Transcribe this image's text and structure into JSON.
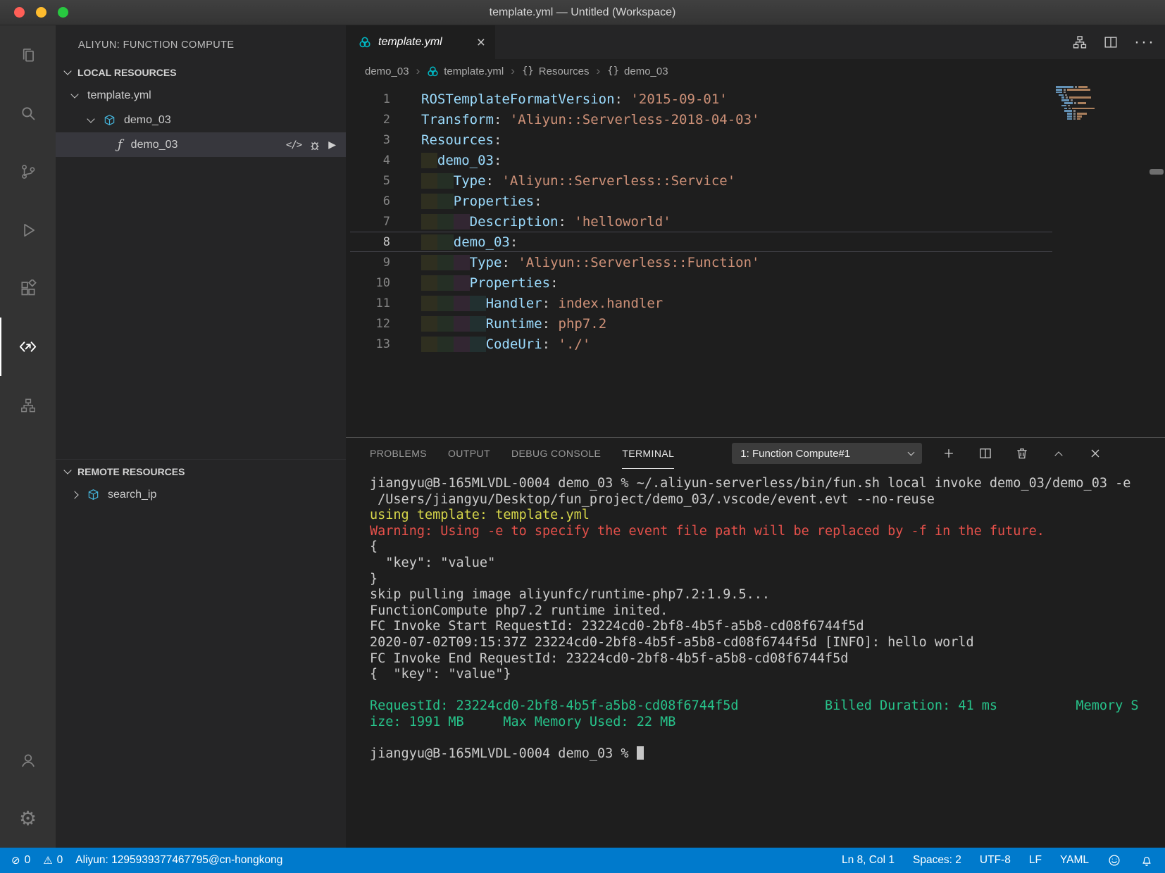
{
  "window": {
    "title": "template.yml — Untitled (Workspace)"
  },
  "colors": {
    "statusbar": "#007acc",
    "yaml_key": "#9cdcfe",
    "yaml_string": "#ce9178",
    "terminal_yellow": "#d6d64a",
    "terminal_red": "#e4504a",
    "terminal_green": "#27c28a"
  },
  "activitybar": {
    "items": [
      "explorer",
      "search",
      "source-control",
      "run-debug",
      "extensions",
      "aliyun-serverless",
      "deploy-tool",
      "accounts",
      "settings"
    ],
    "active": "aliyun-serverless"
  },
  "sidebar": {
    "title": "ALIYUN: FUNCTION COMPUTE",
    "local_header": "LOCAL RESOURCES",
    "remote_header": "REMOTE RESOURCES",
    "local_items": [
      {
        "label": "template.yml",
        "chevron": "down",
        "icon": "none",
        "indent": 0
      },
      {
        "label": "demo_03",
        "chevron": "down",
        "icon": "cube",
        "indent": 1
      },
      {
        "label": "demo_03",
        "chevron": "none",
        "icon": "function",
        "indent": 2,
        "selected": true,
        "actions": [
          "code",
          "debug",
          "run"
        ]
      }
    ],
    "remote_items": [
      {
        "label": "search_ip",
        "chevron": "right",
        "icon": "cube",
        "indent": 0
      }
    ]
  },
  "editor": {
    "tab": {
      "label": "template.yml"
    },
    "breadcrumbs": [
      {
        "label": "demo_03",
        "icon": "none"
      },
      {
        "label": "template.yml",
        "icon": "aliyun"
      },
      {
        "label": "Resources",
        "icon": "braces"
      },
      {
        "label": "demo_03",
        "icon": "braces"
      }
    ],
    "current_line": 8,
    "lines": [
      {
        "n": 1,
        "i": 0,
        "tk": [
          [
            "k",
            "ROSTemplateFormatVersion"
          ],
          [
            "p",
            ": "
          ],
          [
            "s",
            "'2015-09-01'"
          ]
        ]
      },
      {
        "n": 2,
        "i": 0,
        "tk": [
          [
            "k",
            "Transform"
          ],
          [
            "p",
            ": "
          ],
          [
            "s",
            "'Aliyun::Serverless-2018-04-03'"
          ]
        ]
      },
      {
        "n": 3,
        "i": 0,
        "tk": [
          [
            "k",
            "Resources"
          ],
          [
            "p",
            ":"
          ]
        ]
      },
      {
        "n": 4,
        "i": 1,
        "tk": [
          [
            "k",
            "demo_03"
          ],
          [
            "p",
            ":"
          ]
        ]
      },
      {
        "n": 5,
        "i": 2,
        "tk": [
          [
            "k",
            "Type"
          ],
          [
            "p",
            ": "
          ],
          [
            "s",
            "'Aliyun::Serverless::Service'"
          ]
        ]
      },
      {
        "n": 6,
        "i": 2,
        "tk": [
          [
            "k",
            "Properties"
          ],
          [
            "p",
            ":"
          ]
        ]
      },
      {
        "n": 7,
        "i": 3,
        "tk": [
          [
            "k",
            "Description"
          ],
          [
            "p",
            ": "
          ],
          [
            "s",
            "'helloworld'"
          ]
        ]
      },
      {
        "n": 8,
        "i": 2,
        "tk": [
          [
            "k",
            "demo_03"
          ],
          [
            "p",
            ":"
          ]
        ]
      },
      {
        "n": 9,
        "i": 3,
        "tk": [
          [
            "k",
            "Type"
          ],
          [
            "p",
            ": "
          ],
          [
            "s",
            "'Aliyun::Serverless::Function'"
          ]
        ]
      },
      {
        "n": 10,
        "i": 3,
        "tk": [
          [
            "k",
            "Properties"
          ],
          [
            "p",
            ":"
          ]
        ]
      },
      {
        "n": 11,
        "i": 4,
        "tk": [
          [
            "k",
            "Handler"
          ],
          [
            "p",
            ": "
          ],
          [
            "s",
            "index.handler"
          ]
        ]
      },
      {
        "n": 12,
        "i": 4,
        "tk": [
          [
            "k",
            "Runtime"
          ],
          [
            "p",
            ": "
          ],
          [
            "s",
            "php7.2"
          ]
        ]
      },
      {
        "n": 13,
        "i": 4,
        "tk": [
          [
            "k",
            "CodeUri"
          ],
          [
            "p",
            ": "
          ],
          [
            "s",
            "'./'"
          ]
        ]
      }
    ]
  },
  "panel": {
    "tabs": [
      {
        "label": "PROBLEMS",
        "active": false
      },
      {
        "label": "OUTPUT",
        "active": false
      },
      {
        "label": "DEBUG CONSOLE",
        "active": false
      },
      {
        "label": "TERMINAL",
        "active": true
      }
    ],
    "terminal_select": "1: Function Compute#1",
    "terminal_lines": [
      {
        "c": "d",
        "t": "jiangyu@B-165MLVDL-0004 demo_03 % ~/.aliyun-serverless/bin/fun.sh local invoke demo_03/demo_03 -e"
      },
      {
        "c": "d",
        "t": " /Users/jiangyu/Desktop/fun_project/demo_03/.vscode/event.evt --no-reuse"
      },
      {
        "c": "y",
        "t": "using template: template.yml"
      },
      {
        "c": "r",
        "t": "Warning: Using -e to specify the event file path will be replaced by -f in the future."
      },
      {
        "c": "d",
        "t": "{"
      },
      {
        "c": "d",
        "t": "  \"key\": \"value\""
      },
      {
        "c": "d",
        "t": "}"
      },
      {
        "c": "d",
        "t": "skip pulling image aliyunfc/runtime-php7.2:1.9.5..."
      },
      {
        "c": "d",
        "t": "FunctionCompute php7.2 runtime inited."
      },
      {
        "c": "d",
        "t": "FC Invoke Start RequestId: 23224cd0-2bf8-4b5f-a5b8-cd08f6744f5d"
      },
      {
        "c": "d",
        "t": "2020-07-02T09:15:37Z 23224cd0-2bf8-4b5f-a5b8-cd08f6744f5d [INFO]: hello world"
      },
      {
        "c": "d",
        "t": "FC Invoke End RequestId: 23224cd0-2bf8-4b5f-a5b8-cd08f6744f5d"
      },
      {
        "c": "d",
        "t": "{  \"key\": \"value\"}"
      },
      {
        "c": "d",
        "t": ""
      },
      {
        "c": "g",
        "t": "RequestId: 23224cd0-2bf8-4b5f-a5b8-cd08f6744f5d           Billed Duration: 41 ms          Memory S"
      },
      {
        "c": "g",
        "t": "ize: 1991 MB     Max Memory Used: 22 MB"
      },
      {
        "c": "d",
        "t": ""
      },
      {
        "c": "p",
        "t": "jiangyu@B-165MLVDL-0004 demo_03 % "
      }
    ]
  },
  "statusbar": {
    "left": [
      {
        "name": "errors",
        "text": "0"
      },
      {
        "name": "warnings",
        "text": "0"
      },
      {
        "name": "aliyun-account",
        "text": "Aliyun: 1295939377467795@cn-hongkong"
      }
    ],
    "right": [
      {
        "name": "cursor-position",
        "text": "Ln 8, Col 1"
      },
      {
        "name": "indentation",
        "text": "Spaces: 2"
      },
      {
        "name": "encoding",
        "text": "UTF-8"
      },
      {
        "name": "eol",
        "text": "LF"
      },
      {
        "name": "language-mode",
        "text": "YAML"
      }
    ]
  }
}
